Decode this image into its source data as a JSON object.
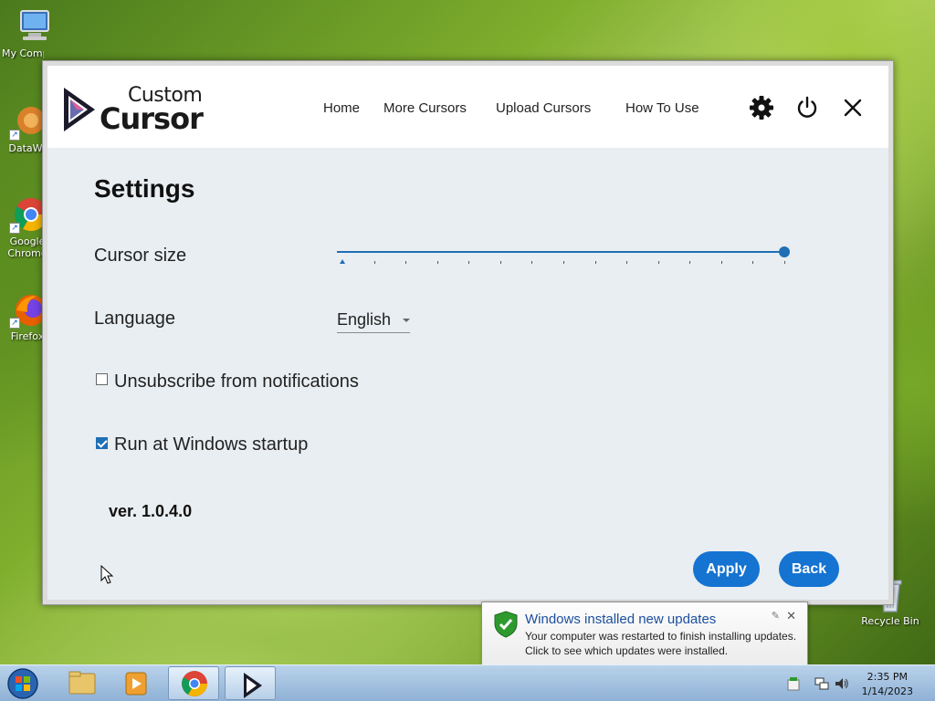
{
  "desktop": {
    "icons": [
      {
        "label": "My Computer"
      },
      {
        "label": "DataWa"
      },
      {
        "label": "Google Chrome"
      },
      {
        "label": "Firefox"
      },
      {
        "label": "Recycle Bin"
      }
    ]
  },
  "app": {
    "logo": {
      "top": "Custom",
      "bottom": "Cursor"
    },
    "nav": [
      "Home",
      "More Cursors",
      "Upload Cursors",
      "How To Use"
    ],
    "icons": {
      "settings": "gear-icon",
      "power": "power-icon",
      "close": "close-icon"
    },
    "settings": {
      "title": "Settings",
      "cursor_size_label": "Cursor size",
      "cursor_size_value": 1.0,
      "language_label": "Language",
      "language_value": "English",
      "unsubscribe_label": "Unsubscribe from notifications",
      "unsubscribe_checked": false,
      "startup_label": "Run at Windows startup",
      "startup_checked": true,
      "version": "ver. 1.0.4.0"
    },
    "buttons": {
      "apply": "Apply",
      "back": "Back"
    },
    "colors": {
      "accent": "#1573d1",
      "header_bg": "#ffffff",
      "body_bg": "#e9eef2"
    }
  },
  "notification": {
    "title": "Windows installed new updates",
    "line1": "Your computer was restarted to finish installing updates.",
    "line2": "Click to see which updates were installed."
  },
  "taskbar": {
    "time": "2:35 PM",
    "date": "1/14/2023"
  }
}
